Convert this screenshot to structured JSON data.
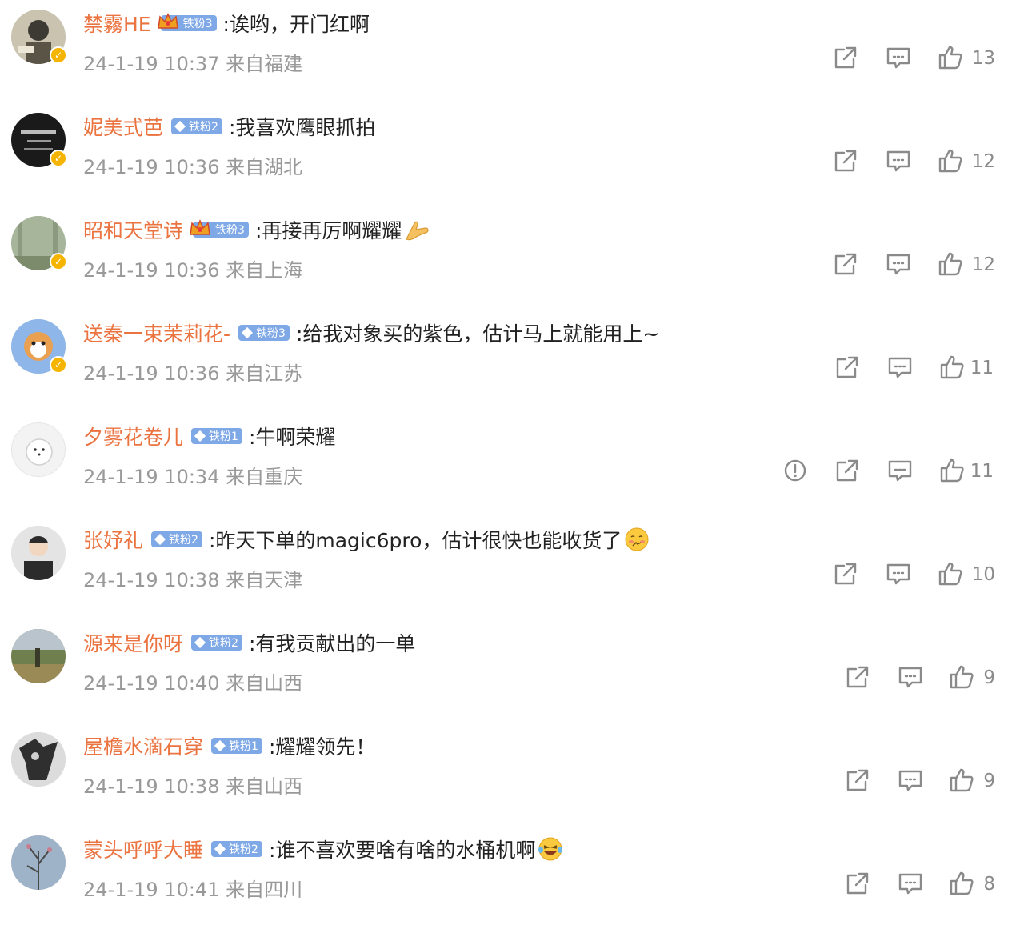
{
  "colors": {
    "username": "#eb7340",
    "badge": "#7fa8e6",
    "meta": "#999999",
    "icon": "#8a8a8a",
    "verified": "#f5b400"
  },
  "icons": {
    "report": "report-icon",
    "share": "share-icon",
    "reply": "reply-icon",
    "like": "like-icon"
  },
  "comments": [
    {
      "user": "禁霧HE",
      "badge": "铁粉3",
      "crown": true,
      "text": ":诶哟，开门红啊",
      "emoji": "",
      "time": "24-1-19 10:37 来自福建",
      "likes": "13",
      "verified": true,
      "report": false
    },
    {
      "user": "妮美式芭",
      "badge": "铁粉2",
      "crown": false,
      "text": ":我喜欢鹰眼抓拍",
      "emoji": "",
      "time": "24-1-19 10:36 来自湖北",
      "likes": "12",
      "verified": true,
      "report": false
    },
    {
      "user": "昭和天堂诗",
      "badge": "铁粉3",
      "crown": true,
      "text": ":再接再厉啊耀耀",
      "emoji": "hands",
      "time": "24-1-19 10:36 来自上海",
      "likes": "12",
      "verified": true,
      "report": false
    },
    {
      "user": "送秦一束茉莉花-",
      "badge": "铁粉3",
      "crown": false,
      "text": ":给我对象买的紫色，估计马上就能用上~",
      "emoji": "",
      "time": "24-1-19 10:36 来自江苏",
      "likes": "11",
      "verified": true,
      "report": false
    },
    {
      "user": "夕雾花卷儿",
      "badge": "铁粉1",
      "crown": false,
      "text": ":牛啊荣耀",
      "emoji": "",
      "time": "24-1-19 10:34 来自重庆",
      "likes": "11",
      "verified": false,
      "report": true
    },
    {
      "user": "张妤礼",
      "badge": "铁粉2",
      "crown": false,
      "text": ":昨天下单的magic6pro，估计很快也能收货了",
      "emoji": "shy",
      "time": "24-1-19 10:38 来自天津",
      "likes": "10",
      "verified": false,
      "report": false
    },
    {
      "user": "源来是你呀",
      "badge": "铁粉2",
      "crown": false,
      "text": ":有我贡献出的一单",
      "emoji": "",
      "time": "24-1-19 10:40 来自山西",
      "likes": "9",
      "verified": false,
      "report": false
    },
    {
      "user": "屋檐水滴石穿",
      "badge": "铁粉1",
      "crown": false,
      "text": ":耀耀领先！",
      "emoji": "",
      "time": "24-1-19 10:38 来自山西",
      "likes": "9",
      "verified": false,
      "report": false
    },
    {
      "user": "蒙头呼呼大睡",
      "badge": "铁粉2",
      "crown": false,
      "text": ":谁不喜欢要啥有啥的水桶机啊",
      "emoji": "laugh",
      "time": "24-1-19 10:41 来自四川",
      "likes": "8",
      "verified": false,
      "report": false
    }
  ]
}
